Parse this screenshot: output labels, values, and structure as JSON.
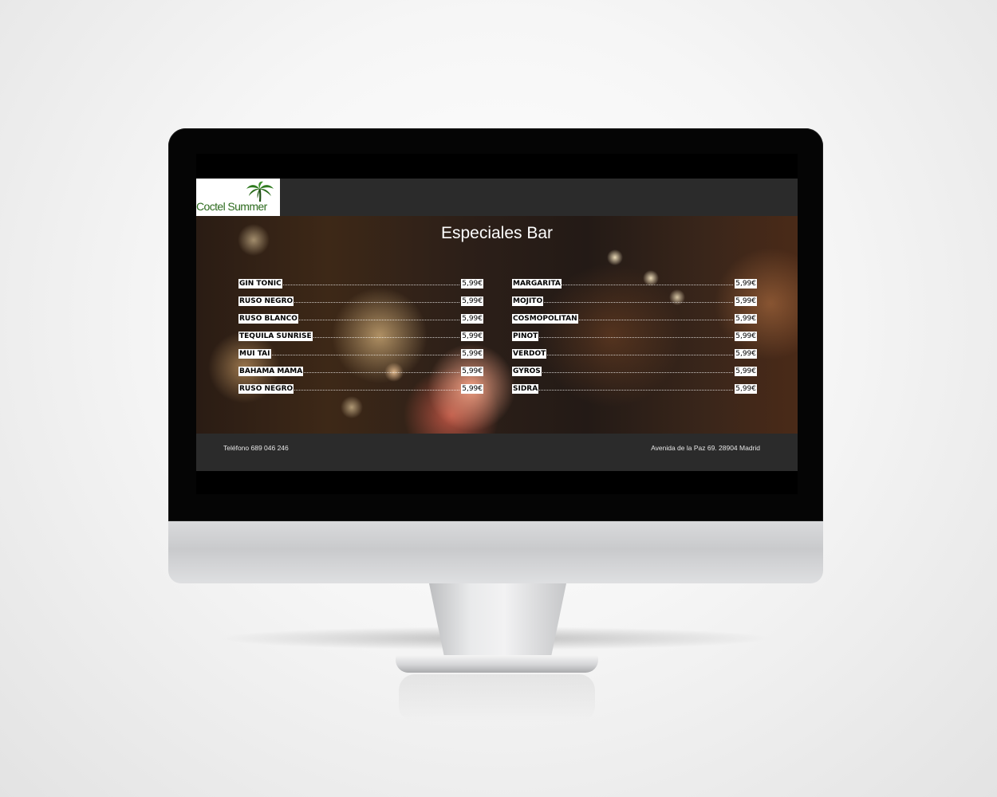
{
  "brand": {
    "logo_text": "Coctel Summer",
    "logo_icon": "palm-tree-icon",
    "logo_color": "#2d6b1e"
  },
  "hero": {
    "title": "Especiales Bar"
  },
  "menu": {
    "left": [
      {
        "name": "GIN TONIC",
        "price": "5,99€"
      },
      {
        "name": "RUSO NEGRO",
        "price": "5,99€"
      },
      {
        "name": "RUSO BLANCO",
        "price": "5,99€"
      },
      {
        "name": "TEQUILA SUNRISE",
        "price": "5,99€"
      },
      {
        "name": "MUI TAI",
        "price": "5,99€"
      },
      {
        "name": "BAHAMA MAMA",
        "price": "5,99€"
      },
      {
        "name": "RUSO NEGRO",
        "price": "5,99€"
      }
    ],
    "right": [
      {
        "name": "MARGARITA",
        "price": "5,99€"
      },
      {
        "name": "MOJITO",
        "price": "5,99€"
      },
      {
        "name": "COSMOPOLITAN",
        "price": "5,99€"
      },
      {
        "name": "PINOT",
        "price": "5,99€"
      },
      {
        "name": "VERDOT",
        "price": "5,99€"
      },
      {
        "name": "GYROS",
        "price": "5,99€"
      },
      {
        "name": "SIDRA",
        "price": "5,99€"
      }
    ]
  },
  "footer": {
    "phone": "Teléfono 689 046 246",
    "address": "Avenida de la Paz 69. 28904 Madrid"
  },
  "colors": {
    "header_bg": "#2b2b2b",
    "screen_bg": "#000000",
    "price_tag_bg": "#ffffff"
  }
}
